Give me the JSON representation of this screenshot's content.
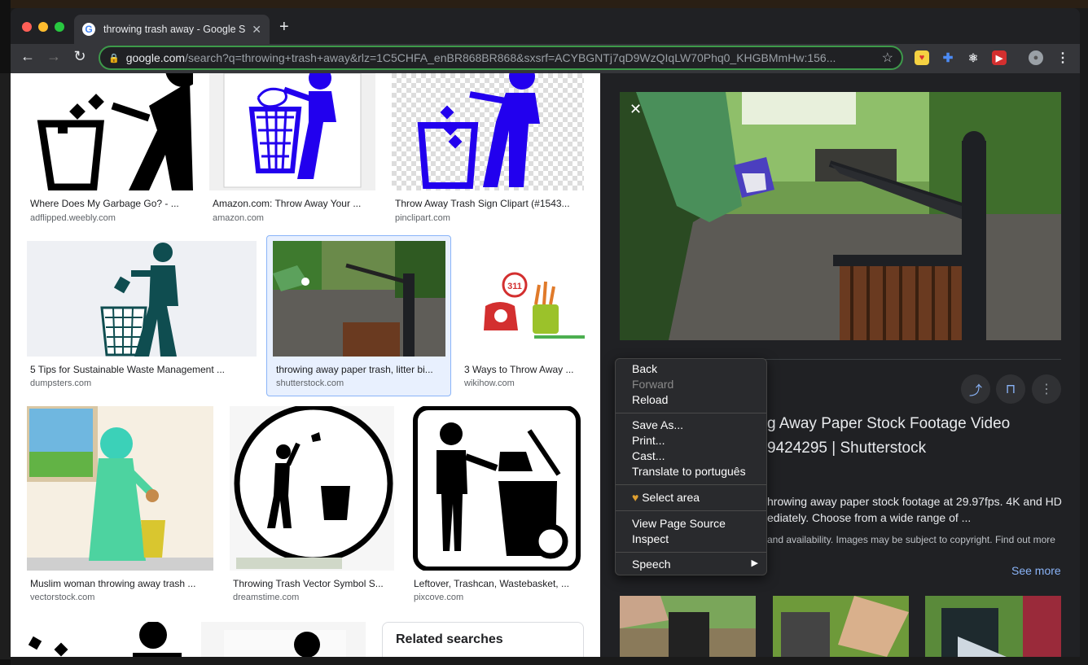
{
  "tab": {
    "title": "throwing trash away - Google S",
    "favicon_letter": "G",
    "close": "✕",
    "new_tab": "+"
  },
  "address": {
    "host": "google.com",
    "path": "/search?q=throwing+trash+away&rlz=1C5CHFA_enBR868BR868&sxsrf=ACYBGNTj7qD9WzQIqLW70Phq0_KHGBMmHw:156..."
  },
  "results": [
    {
      "caption": "Where Does My Garbage Go? - ...",
      "source": "adflipped.weebly.com"
    },
    {
      "caption": "Amazon.com: Throw Away Your ...",
      "source": "amazon.com"
    },
    {
      "caption": "Throw Away Trash Sign Clipart (#1543...",
      "source": "pinclipart.com"
    },
    {
      "caption": "5 Tips for Sustainable Waste Management ...",
      "source": "dumpsters.com"
    },
    {
      "caption": "throwing away paper trash, litter bi...",
      "source": "shutterstock.com"
    },
    {
      "caption": "3 Ways to Throw Away ...",
      "source": "wikihow.com"
    },
    {
      "caption": "Muslim woman throwing away trash ...",
      "source": "vectorstock.com"
    },
    {
      "caption": "Throwing Trash Vector Symbol S...",
      "source": "dreamstime.com"
    },
    {
      "caption": "Leftover, Trashcan, Wastebasket, ...",
      "source": "pixcove.com"
    }
  ],
  "phone_number": "311",
  "related": {
    "title": "Related searches"
  },
  "panel": {
    "close": "✕",
    "title_line1": "g Away Paper Stock Footage Video",
    "title_line2": "9424295 | Shutterstock",
    "desc_line1": "hrowing away paper stock footage at 29.97fps. 4K and HD",
    "desc_line2": "ediately. Choose from a wide range of ...",
    "copyright": "and availability. Images may be subject to copyright.",
    "find_out_more": "Find out more",
    "see_more": "See more"
  },
  "context_menu": {
    "back": "Back",
    "forward": "Forward",
    "reload": "Reload",
    "save_as": "Save As...",
    "print": "Print...",
    "cast": "Cast...",
    "translate": "Translate to português",
    "select_area": "Select area",
    "view_source": "View Page Source",
    "inspect": "Inspect",
    "speech": "Speech"
  },
  "icons": {
    "share": "share-icon",
    "bookmark": "bookmark-icon",
    "more": "more-vert-icon"
  },
  "colors": {
    "accent": "#8ab4f8",
    "omnibox_border": "#3d9a4a",
    "trash_blue": "#2200ee",
    "trash_teal": "#0f4d50"
  }
}
